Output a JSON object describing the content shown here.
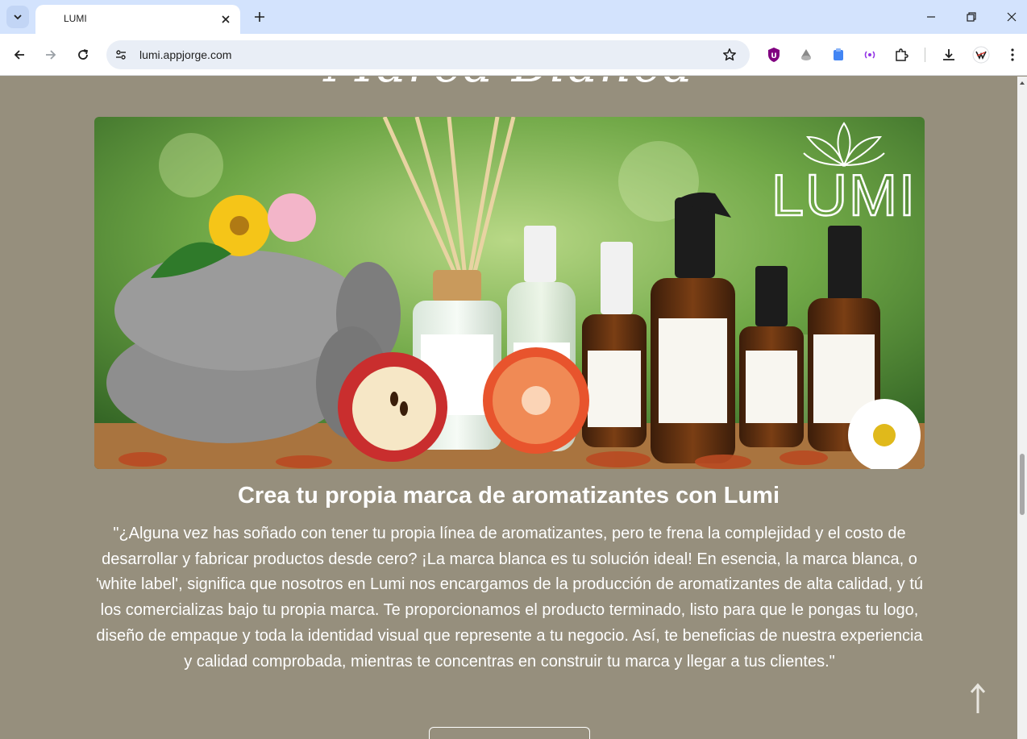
{
  "browser": {
    "tab_title": "LUMI",
    "url": "lumi.appjorge.com",
    "colors": {
      "tabbar": "#d3e3fd",
      "toolbar": "#ffffff",
      "omnibox": "#e9eef6"
    }
  },
  "page": {
    "script_heading": "Marca Blanca",
    "hero_logo": "LUMI",
    "section_title": "Crea tu propia marca de aromatizantes con Lumi",
    "section_text": "\"¿Alguna vez has soñado con tener tu propia línea de aromatizantes, pero te frena la complejidad y el costo de desarrollar y fabricar productos desde cero? ¡La marca blanca es tu solución ideal! En esencia, la marca blanca, o 'white label', significa que nosotros en Lumi nos encargamos de la producción de aromatizantes de alta calidad, y tú los comercializas bajo tu propia marca. Te proporcionamos el producto terminado, listo para que le pongas tu logo, diseño de empaque y toda la identidad visual que represente a tu negocio. Así, te beneficias de nuestra experiencia y calidad comprobada, mientras te concentras en construir tu marca y llegar a tus clientes.\"",
    "colors": {
      "background": "#968f7d",
      "text": "#ffffff"
    }
  },
  "icons": {
    "tab_search": "chevron-down-icon",
    "tab_close": "close-icon",
    "new_tab": "plus-icon",
    "back": "arrow-left-icon",
    "forward": "arrow-right-icon",
    "reload": "reload-icon",
    "site_info": "tune-icon",
    "bookmark": "star-icon",
    "extensions": [
      "ublock-icon",
      "extension-gray-icon",
      "extension-blue-icon",
      "extension-radio-icon",
      "puzzle-icon"
    ],
    "downloads": "download-icon",
    "profile": "avatar-icon",
    "menu": "kebab-menu-icon",
    "back_to_top": "arrow-up-icon"
  }
}
